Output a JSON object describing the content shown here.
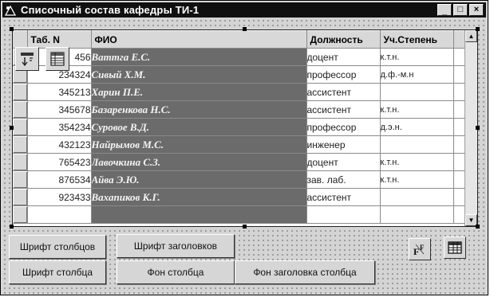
{
  "window": {
    "title": "Списочный состав кафедры ТИ-1",
    "icon": "form-icon",
    "controls": {
      "minimize": "_",
      "maximize": "□",
      "close": "×"
    }
  },
  "grid": {
    "columns": [
      "Таб. N",
      "ФИО",
      "Должность",
      "Уч.Степень"
    ],
    "rows": [
      {
        "tab": "456",
        "fio": "Ваттга Е.С.",
        "position": "доцент",
        "degree": "к.т.н."
      },
      {
        "tab": "234324",
        "fio": "Сивый Х.М.",
        "position": "профессор",
        "degree": "д.ф.-м.н"
      },
      {
        "tab": "345213",
        "fio": "Харин П.Е.",
        "position": "ассистент",
        "degree": ""
      },
      {
        "tab": "345678",
        "fio": "Базаренкова Н.С.",
        "position": "ассистент",
        "degree": "к.т.н."
      },
      {
        "tab": "354234",
        "fio": "Суровое В.Д.",
        "position": "профессор",
        "degree": "д.э.н."
      },
      {
        "tab": "432123",
        "fio": "Найрымов М.С.",
        "position": "инженер",
        "degree": ""
      },
      {
        "tab": "765423",
        "fio": "Лавочкина С.З.",
        "position": "доцент",
        "degree": "к.т.н."
      },
      {
        "tab": "876534",
        "fio": "Айва Э.Ю.",
        "position": "зав. лаб.",
        "degree": "к.т.н."
      },
      {
        "tab": "923433",
        "fio": "Вахапиков К.Г.",
        "position": "ассистент",
        "degree": ""
      }
    ],
    "highlight_color": "#6b6b6b"
  },
  "buttons": {
    "column_font": "Шрифт столбцов",
    "column_font2": "Шрифт столбца",
    "header_font": "Шрифт заголовков",
    "column_bg": "Фон столбца",
    "column_header_bg": "Фон заголовка столбца"
  },
  "icons": {
    "floating_tool_1": "sort-toolbar-icon",
    "floating_tool_2": "grid-table-icon",
    "font_button": "font-size-icon",
    "table_button": "table-icon"
  }
}
